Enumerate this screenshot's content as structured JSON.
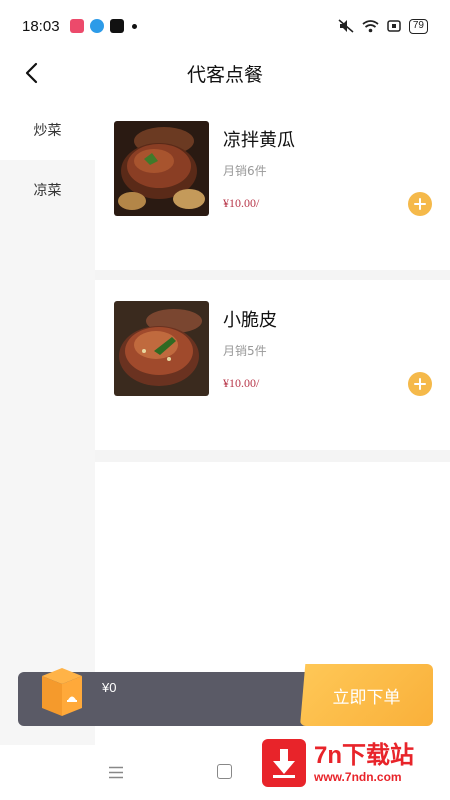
{
  "status_bar": {
    "time": "18:03",
    "battery": "79"
  },
  "header": {
    "title": "代客点餐"
  },
  "sidebar": {
    "categories": [
      {
        "label": "炒菜"
      },
      {
        "label": "凉菜"
      }
    ]
  },
  "dishes": [
    {
      "name": "凉拌黄瓜",
      "sales": "月销6件",
      "price": "¥10.00/"
    },
    {
      "name": "小脆皮",
      "sales": "月销5件",
      "price": "¥10.00/"
    }
  ],
  "cart": {
    "amount": "¥0",
    "order_button": "立即下单"
  },
  "watermark": {
    "title": "7n下载站",
    "url": "www.7ndn.com"
  },
  "colors": {
    "accent": "#f5b94a",
    "price": "#b8374a",
    "cart_bar": "#5a5a66",
    "watermark": "#e8242a"
  }
}
